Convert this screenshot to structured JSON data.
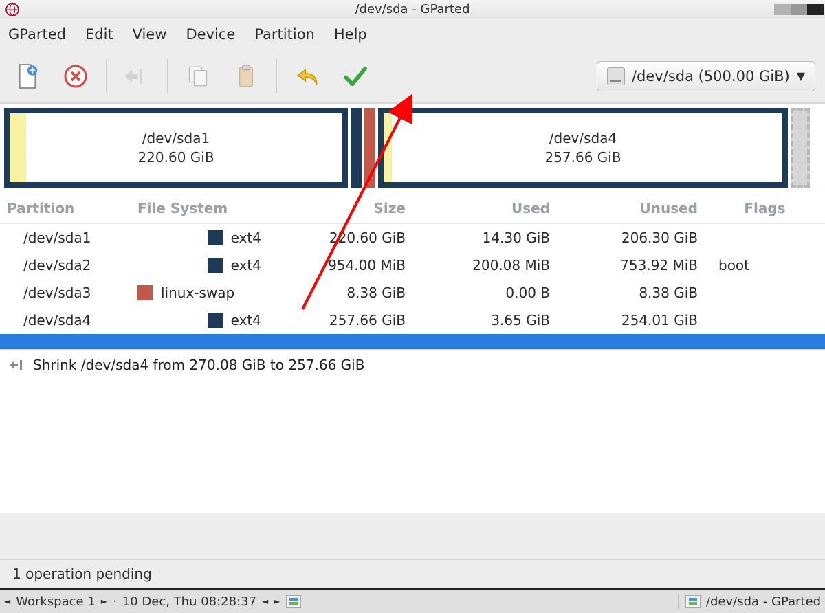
{
  "titlebar": {
    "title": "/dev/sda - GParted"
  },
  "menu": {
    "gparted": "GParted",
    "edit": "Edit",
    "view": "View",
    "device": "Device",
    "partition": "Partition",
    "help": "Help"
  },
  "device": {
    "label": "/dev/sda (500.00 GiB)"
  },
  "viz": {
    "p1_name": "/dev/sda1",
    "p1_size": "220.60 GiB",
    "p4_name": "/dev/sda4",
    "p4_size": "257.66 GiB"
  },
  "headers": {
    "partition": "Partition",
    "fs": "File System",
    "size": "Size",
    "used": "Used",
    "unused": "Unused",
    "flags": "Flags"
  },
  "rows": [
    {
      "part": "/dev/sda1",
      "fs": "ext4",
      "swatch": "sw-ext4",
      "size": "220.60 GiB",
      "used": "14.30 GiB",
      "unused": "206.30 GiB",
      "flags": ""
    },
    {
      "part": "/dev/sda2",
      "fs": "ext4",
      "swatch": "sw-ext4",
      "size": "954.00 MiB",
      "used": "200.08 MiB",
      "unused": "753.92 MiB",
      "flags": "boot"
    },
    {
      "part": "/dev/sda3",
      "fs": "linux-swap",
      "swatch": "sw-swap",
      "size": "8.38 GiB",
      "used": "0.00 B",
      "unused": "8.38 GiB",
      "flags": ""
    },
    {
      "part": "/dev/sda4",
      "fs": "ext4",
      "swatch": "sw-ext4",
      "size": "257.66 GiB",
      "used": "3.65 GiB",
      "unused": "254.01 GiB",
      "flags": ""
    }
  ],
  "ops": {
    "op1": "Shrink /dev/sda4 from 270.08 GiB to 257.66 GiB"
  },
  "status": {
    "text": "1 operation pending"
  },
  "taskbar": {
    "workspace": "Workspace 1",
    "clock": "10 Dec, Thu 08:28:37",
    "task": "/dev/sda - GParted"
  }
}
